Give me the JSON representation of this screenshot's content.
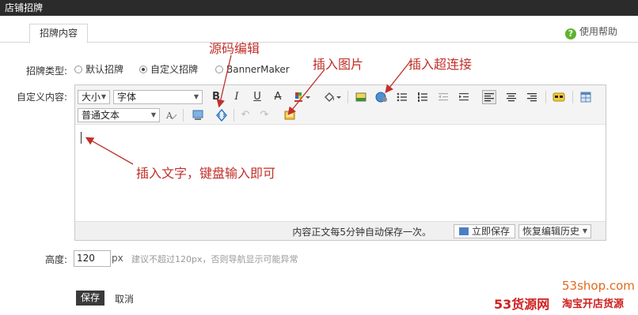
{
  "window": {
    "title": "店铺招牌"
  },
  "tabs": [
    {
      "label": "招牌内容"
    }
  ],
  "help": {
    "label": "使用帮助",
    "icon": "question-icon"
  },
  "type_row": {
    "label": "招牌类型:",
    "options": [
      {
        "label": "默认招牌",
        "checked": false
      },
      {
        "label": "自定义招牌",
        "checked": true
      },
      {
        "label": "BannerMaker",
        "checked": false
      }
    ]
  },
  "content_row": {
    "label": "自定义内容:"
  },
  "toolbar": {
    "font_size": "大小",
    "font_family": "字体",
    "format": "普通文本",
    "bold": "B",
    "italic": "I",
    "underline": "U",
    "strike": "A",
    "buttons": [
      "bold-icon",
      "italic-icon",
      "underline-icon",
      "strikethrough-icon",
      "text-color-icon",
      "background-color-icon",
      "image-icon",
      "link-icon",
      "unordered-list-icon",
      "ordered-list-icon",
      "outdent-icon",
      "indent-icon",
      "align-left-icon",
      "align-center-icon",
      "align-right-icon",
      "emoticon-icon",
      "table-icon",
      "clear-format-icon",
      "insert-block-icon",
      "source-code-icon",
      "undo-icon",
      "redo-icon",
      "insert-image-icon"
    ]
  },
  "statusbar": {
    "autosave": "内容正文每5分钟自动保存一次。",
    "save_now": "立即保存",
    "restore": "恢复编辑历史"
  },
  "height_row": {
    "label": "高度:",
    "value": "120",
    "unit": "px",
    "hint": "建议不超过120px，否则导航显示可能异常"
  },
  "actions": {
    "save": "保存",
    "cancel": "取消"
  },
  "annotations": {
    "source": "源码编辑",
    "image": "插入图片",
    "link": "插入超连接",
    "text": "插入文字，键盘输入即可"
  },
  "watermark": {
    "logo": "53货源网",
    "site": "53shop.com",
    "slogan": "淘宝开店货源"
  },
  "colors": {
    "annotation": "#c0302a",
    "titlebar": "#2b2b2b",
    "help_icon": "#5cb32e"
  }
}
